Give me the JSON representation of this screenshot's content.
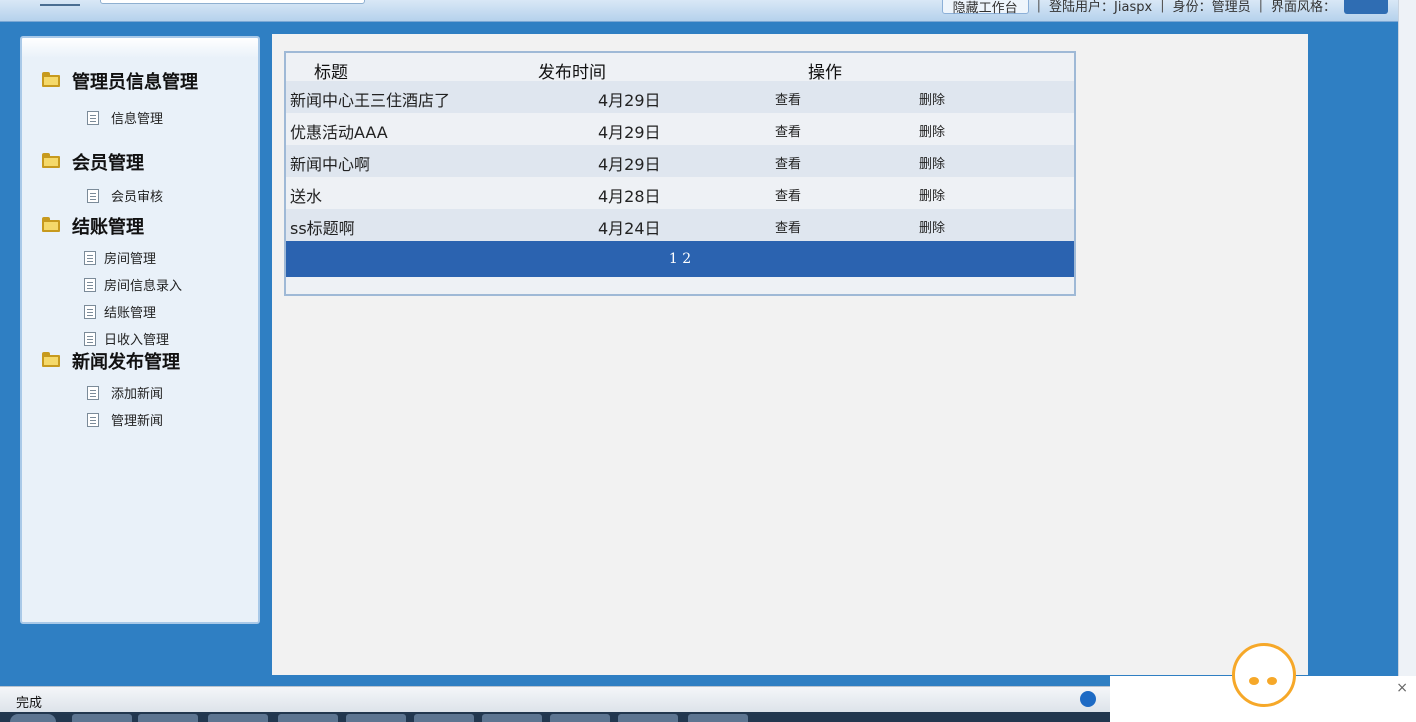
{
  "header": {
    "hide_button": "隐藏工作台",
    "user_info": "登陆用户：Jiaspx",
    "role_info": "身份：管理员",
    "theme_info": "界面风格："
  },
  "sidebar": {
    "groups": [
      {
        "title": "管理员信息管理",
        "items": [
          "信息管理"
        ]
      },
      {
        "title": "会员管理",
        "items": [
          "会员审核"
        ]
      },
      {
        "title": "结账管理",
        "items": [
          "房间管理",
          "房间信息录入",
          "结账管理",
          "日收入管理"
        ]
      },
      {
        "title": "新闻发布管理",
        "items": [
          "添加新闻",
          "管理新闻"
        ]
      }
    ]
  },
  "table": {
    "headers": {
      "title": "标题",
      "date": "发布时间",
      "action": "操作"
    },
    "rows": [
      {
        "title": "新闻中心王三住酒店了",
        "date": "4月29日",
        "view": "查看",
        "delete": "删除"
      },
      {
        "title": "优惠活动AAA",
        "date": "4月29日",
        "view": "查看",
        "delete": "删除"
      },
      {
        "title": "新闻中心啊",
        "date": "4月29日",
        "view": "查看",
        "delete": "删除"
      },
      {
        "title": "送水",
        "date": "4月28日",
        "view": "查看",
        "delete": "删除"
      },
      {
        "title": "ss标题啊",
        "date": "4月24日",
        "view": "查看",
        "delete": "删除"
      }
    ],
    "pager": "1 2"
  },
  "statusbar": {
    "text": "完成"
  },
  "popup": {
    "close": "×"
  }
}
